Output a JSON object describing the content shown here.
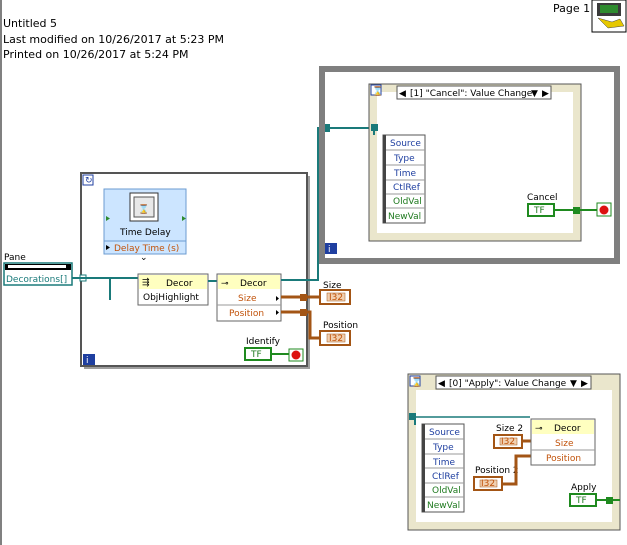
{
  "header": {
    "title": "Untitled 5",
    "modified": "Last modified on 10/26/2017 at 5:23 PM",
    "printed": "Printed on 10/26/2017 at 5:24 PM",
    "page": "Page 1"
  },
  "colors": {
    "cluster_wire": "#1a7a7a",
    "ref_wire": "#008080",
    "numeric_wire": "#a35515",
    "bool_wire": "#1f8a1f",
    "panel_gray": "#7f7f7f",
    "event_cream": "#eae6cc"
  },
  "diagram": {
    "pane_label": "Pane",
    "decorations_control": "Decorations[]",
    "time_delay_title": "Time Delay",
    "time_delay_param": "Delay Time (s)",
    "invoke_node": {
      "class": "Decor",
      "method": "ObjHighlight"
    },
    "property_node_main": {
      "class": "Decor",
      "props": [
        "Size",
        "Position"
      ]
    },
    "size_indicator": "Size",
    "position_indicator": "Position",
    "identify_button": "Identify",
    "bool_tf": "TF",
    "cluster_ind": "I32",
    "iteration_i": "i",
    "event_cancel": {
      "selector": "[1] \"Cancel\": Value Change",
      "fields": [
        "Source",
        "Type",
        "Time",
        "CtlRef",
        "OldVal",
        "NewVal"
      ],
      "button": "Cancel"
    },
    "event_apply": {
      "selector": "[0] \"Apply\": Value Change",
      "fields": [
        "Source",
        "Type",
        "Time",
        "CtlRef",
        "OldVal",
        "NewVal"
      ],
      "size2": "Size 2",
      "position2": "Position 2",
      "property_node": {
        "class": "Decor",
        "props": [
          "Size",
          "Position"
        ]
      },
      "button": "Apply"
    }
  }
}
